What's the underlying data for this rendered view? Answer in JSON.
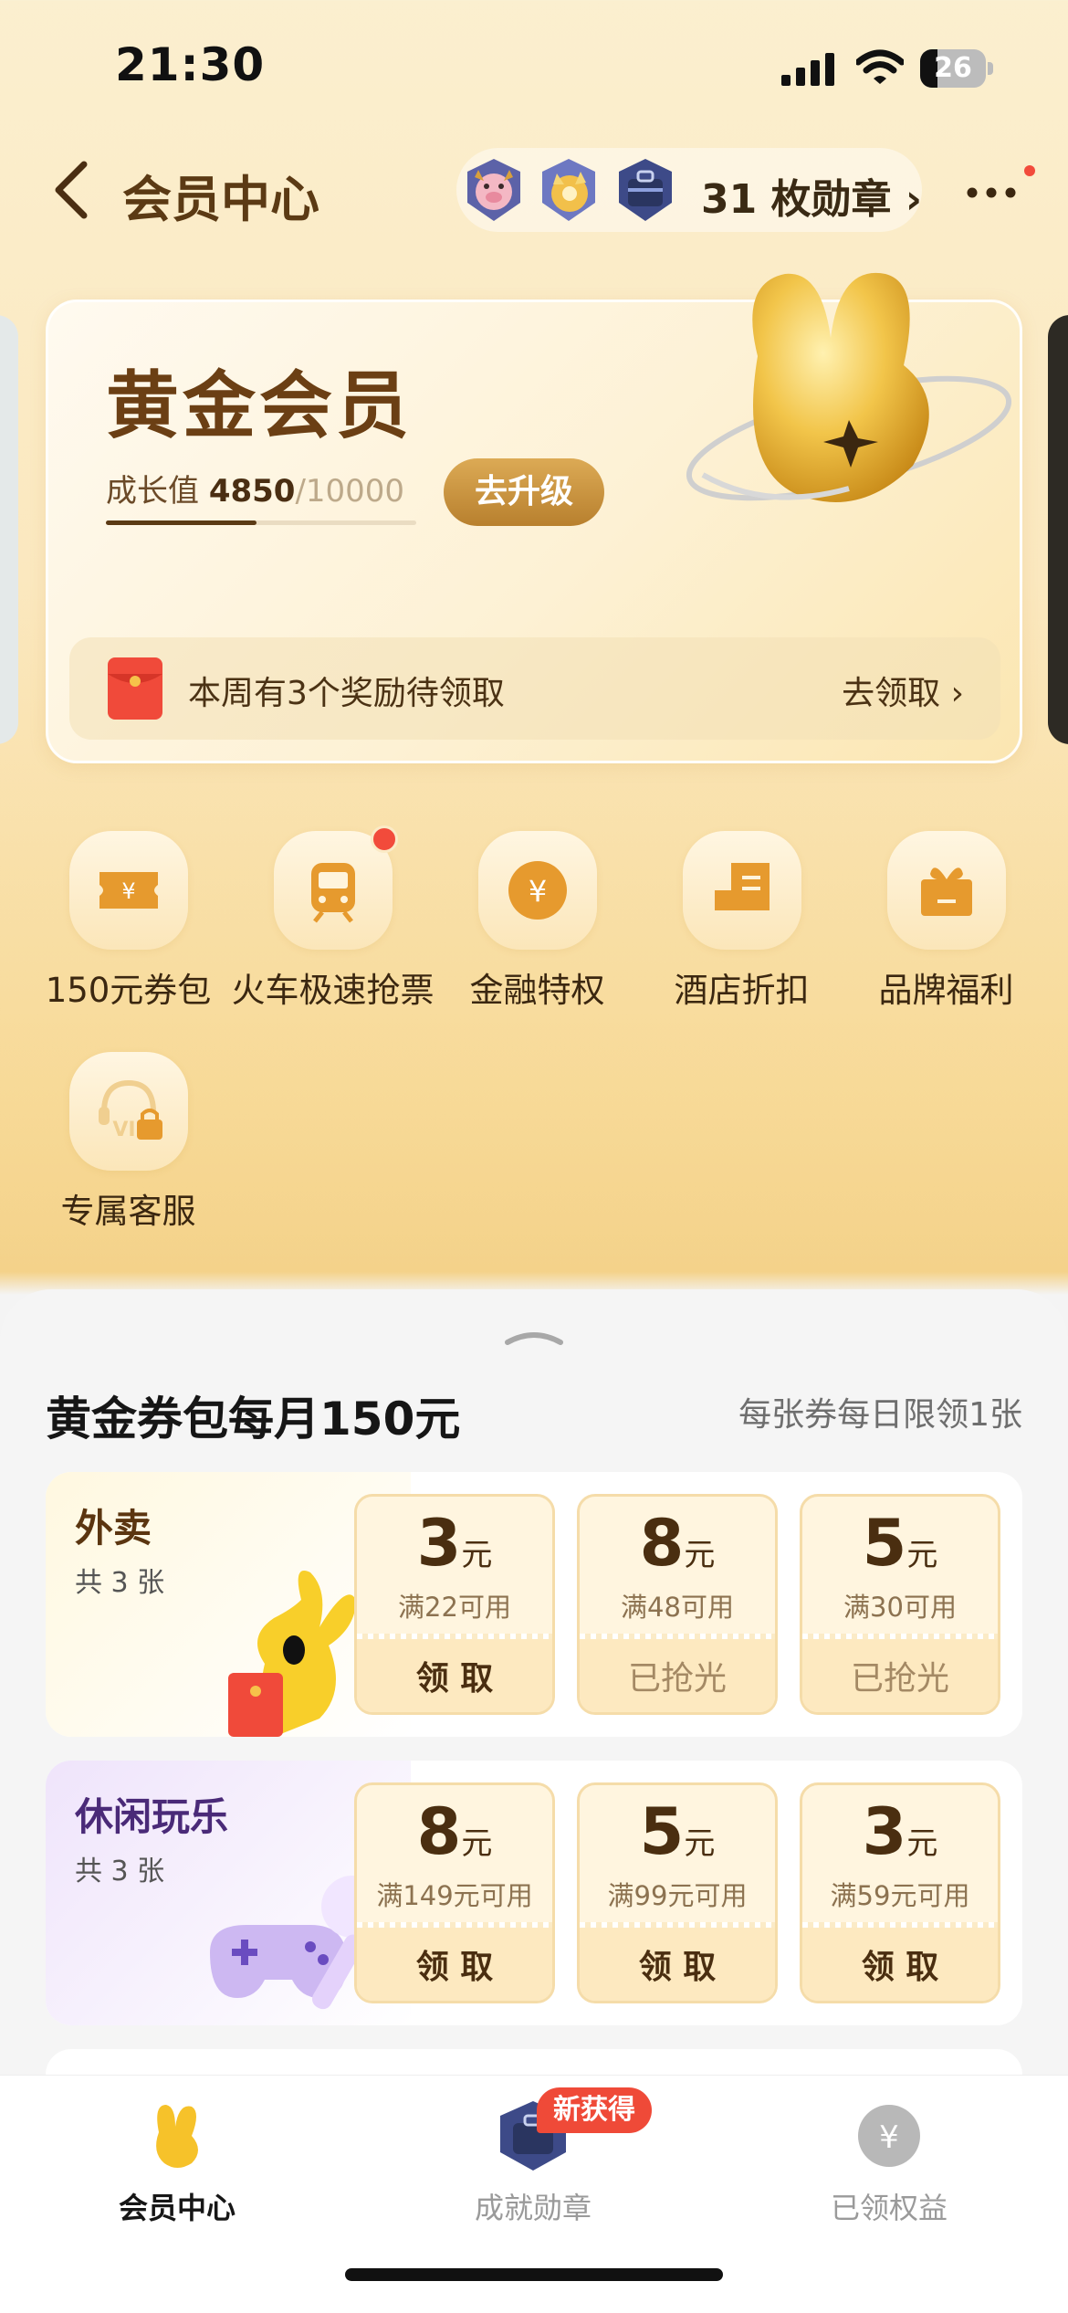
{
  "status": {
    "time": "21:30",
    "battery": "26",
    "battery_level": 0.26
  },
  "header": {
    "title": "会员中心",
    "medal_count": "31 枚勋章"
  },
  "card": {
    "level": "黄金会员",
    "growth_label": "成长值",
    "growth_value": "4850",
    "growth_total": "/10000",
    "growth_fraction": 0.485,
    "upgrade_button": "去升级",
    "reward_text": "本周有3个奖励待领取",
    "reward_link": "去领取"
  },
  "services": [
    {
      "label": "150元券包",
      "icon": "ticket-icon"
    },
    {
      "label": "火车极速抢票",
      "icon": "train-icon"
    },
    {
      "label": "金融特权",
      "icon": "yen-coin-icon"
    },
    {
      "label": "酒店折扣",
      "icon": "hotel-icon"
    },
    {
      "label": "品牌福利",
      "icon": "gift-icon"
    },
    {
      "label": "专属客服",
      "icon": "vip-headset-locked-icon"
    }
  ],
  "coupons": {
    "title": "黄金券包每月150元",
    "note": "每张券每日限领1张",
    "categories": [
      {
        "name": "外卖",
        "count": "共 3 张",
        "name_color": "#5b3510",
        "items": [
          {
            "amount": "3",
            "unit": "元",
            "condition": "满22可用",
            "action": "领 取"
          },
          {
            "amount": "8",
            "unit": "元",
            "condition": "满48可用",
            "action": "已抢光"
          },
          {
            "amount": "5",
            "unit": "元",
            "condition": "满30可用",
            "action": "已抢光"
          }
        ]
      },
      {
        "name": "休闲玩乐",
        "count": "共 3 张",
        "name_color": "#4a2a78",
        "items": [
          {
            "amount": "8",
            "unit": "元",
            "condition": "满149元可用",
            "action": "领 取"
          },
          {
            "amount": "5",
            "unit": "元",
            "condition": "满99元可用",
            "action": "领 取"
          },
          {
            "amount": "3",
            "unit": "元",
            "condition": "满59元可用",
            "action": "领 取"
          }
        ]
      }
    ]
  },
  "tabbar": {
    "tabs": [
      {
        "label": "会员中心",
        "active": true
      },
      {
        "label": "成就勋章",
        "active": false
      },
      {
        "label": "已领权益",
        "active": false
      }
    ],
    "badge": "新获得"
  },
  "colors": {
    "accent": "#b8802e",
    "brand_brown": "#5b3a14",
    "alert_red": "#f24b3b"
  }
}
